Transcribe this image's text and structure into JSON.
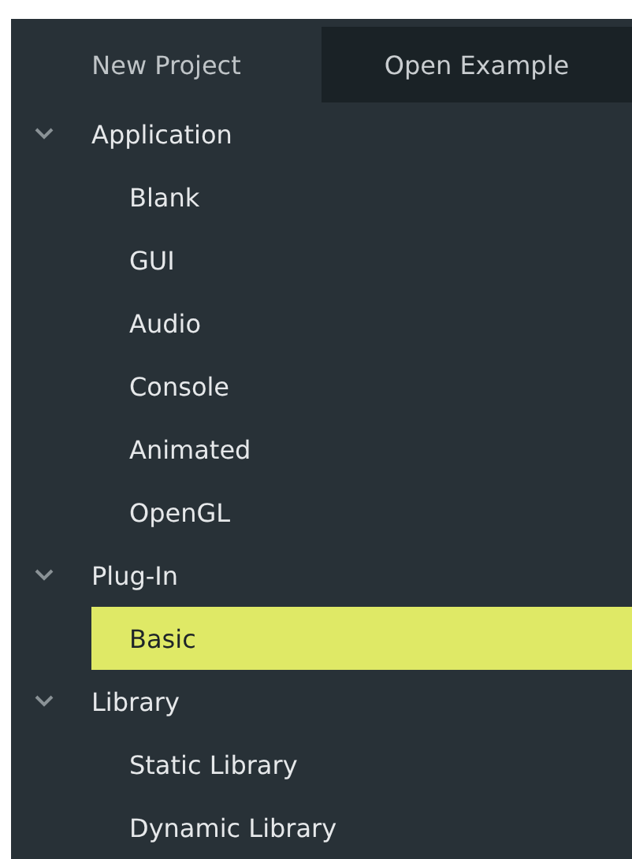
{
  "tabs": [
    {
      "label": "New Project",
      "selected": true
    },
    {
      "label": "Open Example",
      "selected": false
    }
  ],
  "tree": [
    {
      "label": "Application",
      "expanded": true,
      "children": [
        {
          "label": "Blank",
          "selected": false
        },
        {
          "label": "GUI",
          "selected": false
        },
        {
          "label": "Audio",
          "selected": false
        },
        {
          "label": "Console",
          "selected": false
        },
        {
          "label": "Animated",
          "selected": false
        },
        {
          "label": "OpenGL",
          "selected": false
        }
      ]
    },
    {
      "label": "Plug-In",
      "expanded": true,
      "children": [
        {
          "label": "Basic",
          "selected": true
        }
      ]
    },
    {
      "label": "Library",
      "expanded": true,
      "children": [
        {
          "label": "Static Library",
          "selected": false
        },
        {
          "label": "Dynamic Library",
          "selected": false
        }
      ]
    }
  ]
}
